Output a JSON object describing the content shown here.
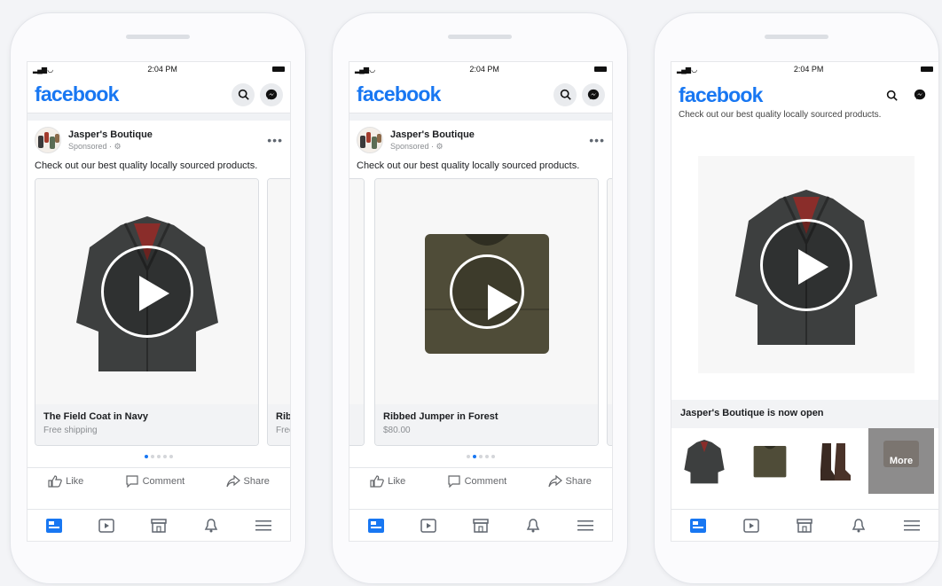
{
  "status": {
    "time": "2:04 PM"
  },
  "app": {
    "logo_text": "facebook"
  },
  "post": {
    "page_name": "Jasper's Boutique",
    "sponsored": "Sponsored · ⚙",
    "caption": "Check out our best quality locally sourced products."
  },
  "phone1": {
    "card1": {
      "title": "The Field Coat in Navy",
      "subtitle": "Free shipping"
    },
    "card2": {
      "title": "Ribb",
      "subtitle": "Free"
    }
  },
  "phone2": {
    "card": {
      "title": "Ribbed Jumper in Forest",
      "subtitle": "$80.00"
    }
  },
  "phone3": {
    "scrolled_caption": "Check out our best quality locally sourced products.",
    "shop_banner": "Jasper's Boutique is now open",
    "more_label": "More"
  },
  "actions": {
    "like": "Like",
    "comment": "Comment",
    "share": "Share"
  },
  "colors": {
    "brand": "#1877f2",
    "jacket": "#3d3f3f",
    "jumper": "#4f4c38"
  },
  "carousel_dots": 5
}
